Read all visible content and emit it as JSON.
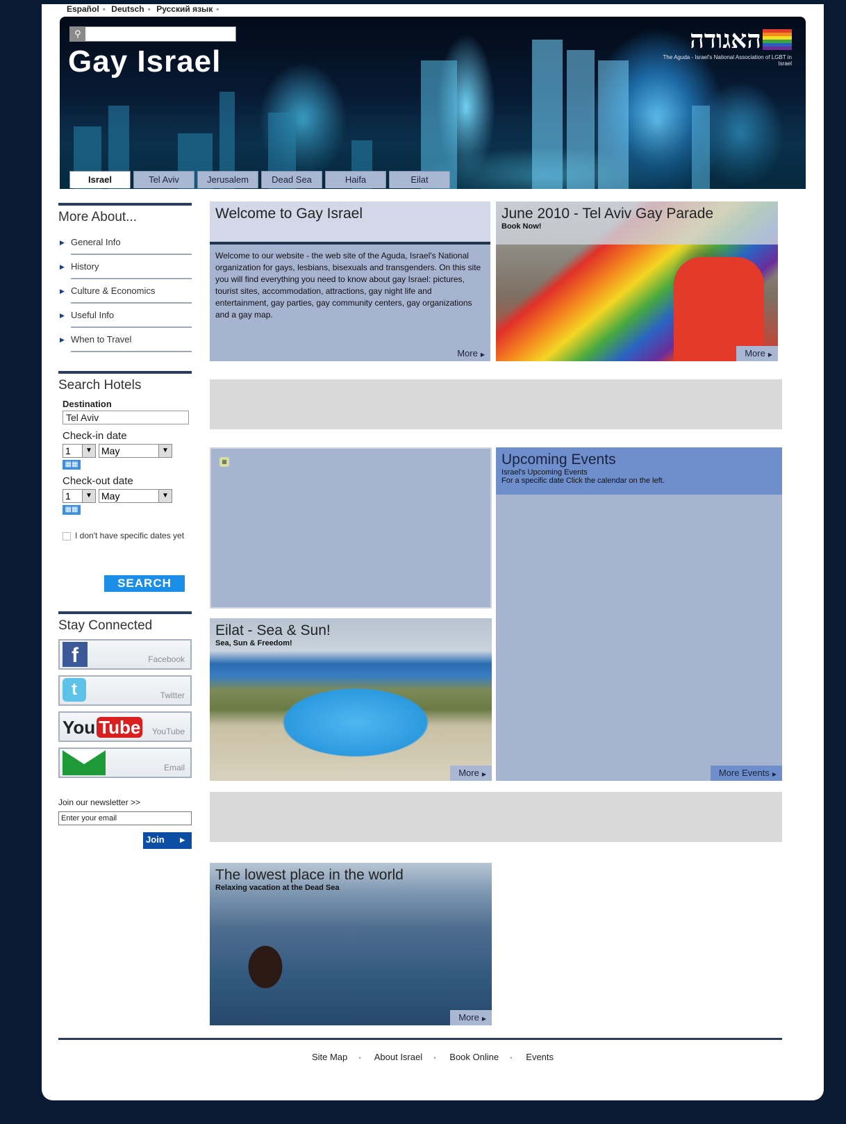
{
  "languages": [
    "Español",
    "Deutsch",
    "Русский язык"
  ],
  "header": {
    "site_title": "Gay Israel",
    "logo_hebrew": "האגודה",
    "logo_subtitle": "The Aguda - Israel's National Association of LGBT in Israel",
    "search_value": ""
  },
  "tabs": [
    "Israel",
    "Tel Aviv",
    "Jerusalem",
    "Dead Sea",
    "Haifa",
    "Eilat"
  ],
  "more_about": {
    "title": "More About...",
    "items": [
      "General Info",
      "History",
      "Culture & Economics",
      "Useful Info",
      "When to Travel"
    ]
  },
  "search_hotels": {
    "title": "Search Hotels",
    "destination_label": "Destination",
    "destination_value": "Tel Aviv",
    "checkin_label": "Check-in date",
    "checkin_day": "1",
    "checkin_month": "May",
    "checkout_label": "Check-out date",
    "checkout_day": "1",
    "checkout_month": "May",
    "no_dates_label": "I don't have specific dates yet",
    "search_button": "SEARCH"
  },
  "stay_connected": {
    "title": "Stay Connected",
    "items": [
      "Facebook",
      "Twitter",
      "YouTube",
      "Email"
    ]
  },
  "newsletter": {
    "label": "Join our newsletter >>",
    "placeholder": "Enter your email",
    "join_button": "Join"
  },
  "welcome": {
    "title": "Welcome to Gay Israel",
    "body": "Welcome to our website - the web site of the Aguda, Israel's National organization for gays, lesbians, bisexuals and transgenders. On this site you will find everything you need to know about gay Israel: pictures, tourist sites, accommodation, attractions, gay night life and entertainment, gay parties, gay community centers, gay organizations and a gay map.",
    "more": "More"
  },
  "parade": {
    "title": "June 2010 - Tel Aviv Gay Parade",
    "subtitle": "Book Now!",
    "more": "More"
  },
  "events": {
    "title": "Upcoming Events",
    "subtitle": "Israel's Upcoming Events",
    "note": "For a specific date Click the calendar on the left.",
    "more": "More Events"
  },
  "eilat": {
    "title": "Eilat - Sea & Sun!",
    "subtitle": "Sea, Sun & Freedom!",
    "more": "More"
  },
  "deadsea": {
    "title": "The lowest place in the world",
    "subtitle": "Relaxing vacation at the Dead Sea",
    "more": "More"
  },
  "footer": {
    "links": [
      "Site Map",
      "About Israel",
      "Book Online",
      "Events"
    ]
  },
  "icons": {
    "search": "magnifier",
    "facebook": "f",
    "twitter": "t",
    "youtube_you": "You",
    "youtube_tube": "Tube",
    "calendar": "cal",
    "more_arrow": "▶"
  }
}
